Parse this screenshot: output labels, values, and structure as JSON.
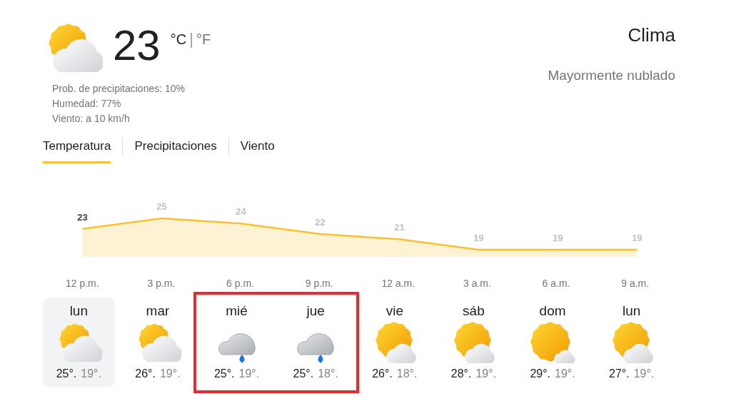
{
  "current": {
    "kind": "partly_cloudy",
    "temperature": "23",
    "unit_c": "°C",
    "unit_separator": "|",
    "unit_f": "°F",
    "details": [
      "Prob. de precipitaciones: 10%",
      "Humedad: 77%",
      "Viento: a 10 km/h"
    ]
  },
  "header": {
    "title": "Clima",
    "condition": "Mayormente nublado"
  },
  "tabs": [
    {
      "label": "Temperatura",
      "selected": true
    },
    {
      "label": "Precipitaciones",
      "selected": false
    },
    {
      "label": "Viento",
      "selected": false
    }
  ],
  "chart": {
    "chart_data": {
      "type": "area",
      "categories": [
        "12 p.m.",
        "3 p.m.",
        "6 p.m.",
        "9 p.m.",
        "12 a.m.",
        "3 a.m.",
        "6 a.m.",
        "9 a.m."
      ],
      "series": [
        {
          "color": "#fbc02d",
          "values": [
            23,
            25,
            24,
            22,
            21,
            19,
            19,
            19
          ]
        }
      ],
      "data_labels": true
    }
  },
  "days": [
    {
      "day": "lun",
      "kind": "partly_cloudy",
      "high": "25°.",
      "low": "19°.",
      "selected": true,
      "highlighted": false
    },
    {
      "day": "mar",
      "kind": "partly_cloudy",
      "high": "26°.",
      "low": "19°.",
      "selected": false,
      "highlighted": false
    },
    {
      "day": "mié",
      "kind": "rain",
      "high": "25°.",
      "low": "19°.",
      "selected": false,
      "highlighted": true
    },
    {
      "day": "jue",
      "kind": "rain",
      "high": "25°.",
      "low": "18°.",
      "selected": false,
      "highlighted": true
    },
    {
      "day": "vie",
      "kind": "mostly_sunny",
      "high": "26°.",
      "low": "18°.",
      "selected": false,
      "highlighted": false
    },
    {
      "day": "sáb",
      "kind": "mostly_sunny",
      "high": "28°.",
      "low": "19°.",
      "selected": false,
      "highlighted": false
    },
    {
      "day": "dom",
      "kind": "sunny",
      "high": "29°.",
      "low": "19°.",
      "selected": false,
      "highlighted": false
    },
    {
      "day": "lun",
      "kind": "mostly_sunny",
      "high": "27°.",
      "low": "19°.",
      "selected": false,
      "highlighted": false
    }
  ]
}
